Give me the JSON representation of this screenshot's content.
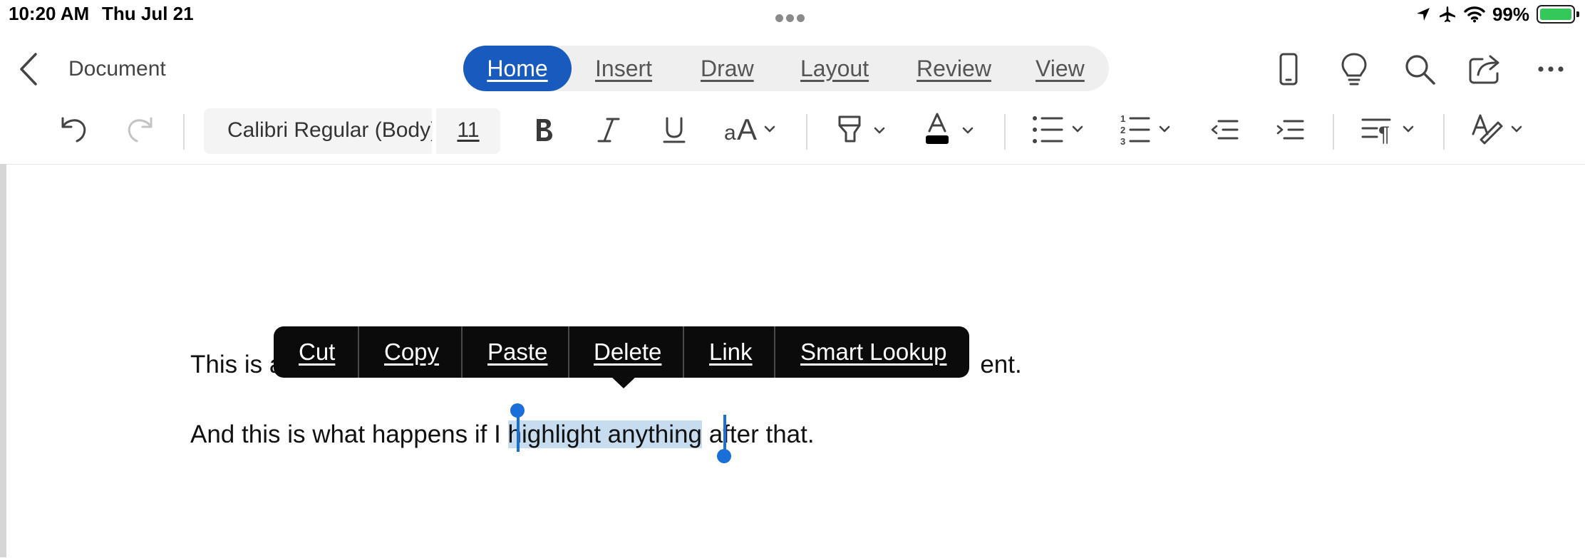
{
  "status_bar": {
    "time": "10:20 AM",
    "date": "Thu Jul 21",
    "battery": "99%",
    "battery_level": 0.99,
    "icons": [
      "location-icon",
      "airplane-icon",
      "wifi-icon",
      "battery-icon"
    ]
  },
  "header": {
    "title": "Document",
    "tabs": [
      {
        "label": "Home",
        "active": true
      },
      {
        "label": "Insert",
        "active": false
      },
      {
        "label": "Draw",
        "active": false
      },
      {
        "label": "Layout",
        "active": false
      },
      {
        "label": "Review",
        "active": false
      },
      {
        "label": "View",
        "active": false
      }
    ],
    "icons": [
      "phone-view-icon",
      "lightbulb-icon",
      "search-icon",
      "share-icon",
      "more-icon"
    ]
  },
  "ribbon": {
    "font_name": "Calibri Regular (Body)",
    "font_size": "11",
    "icons": [
      "undo-icon",
      "redo-icon",
      "bold-icon",
      "italic-icon",
      "underline-icon",
      "font-size-change-icon",
      "highlight-icon",
      "font-color-icon",
      "bullet-list-icon",
      "numbered-list-icon",
      "decrease-indent-icon",
      "increase-indent-icon",
      "paragraph-styles-icon",
      "editor-icon"
    ],
    "font_color": "#000000",
    "accent": "#185abd"
  },
  "document": {
    "line1_start": "This is a",
    "line1_end": "ent.",
    "line2_before": "And this is what happens if I ",
    "line2_selected": "highlight anything",
    "line2_after": " after that."
  },
  "context_menu": {
    "items": [
      "Cut",
      "Copy",
      "Paste",
      "Delete",
      "Link",
      "Smart Lookup"
    ]
  },
  "colors": {
    "selection": "#c8dcf0",
    "handle": "#1a6fd9",
    "active_tab": "#185abd"
  }
}
